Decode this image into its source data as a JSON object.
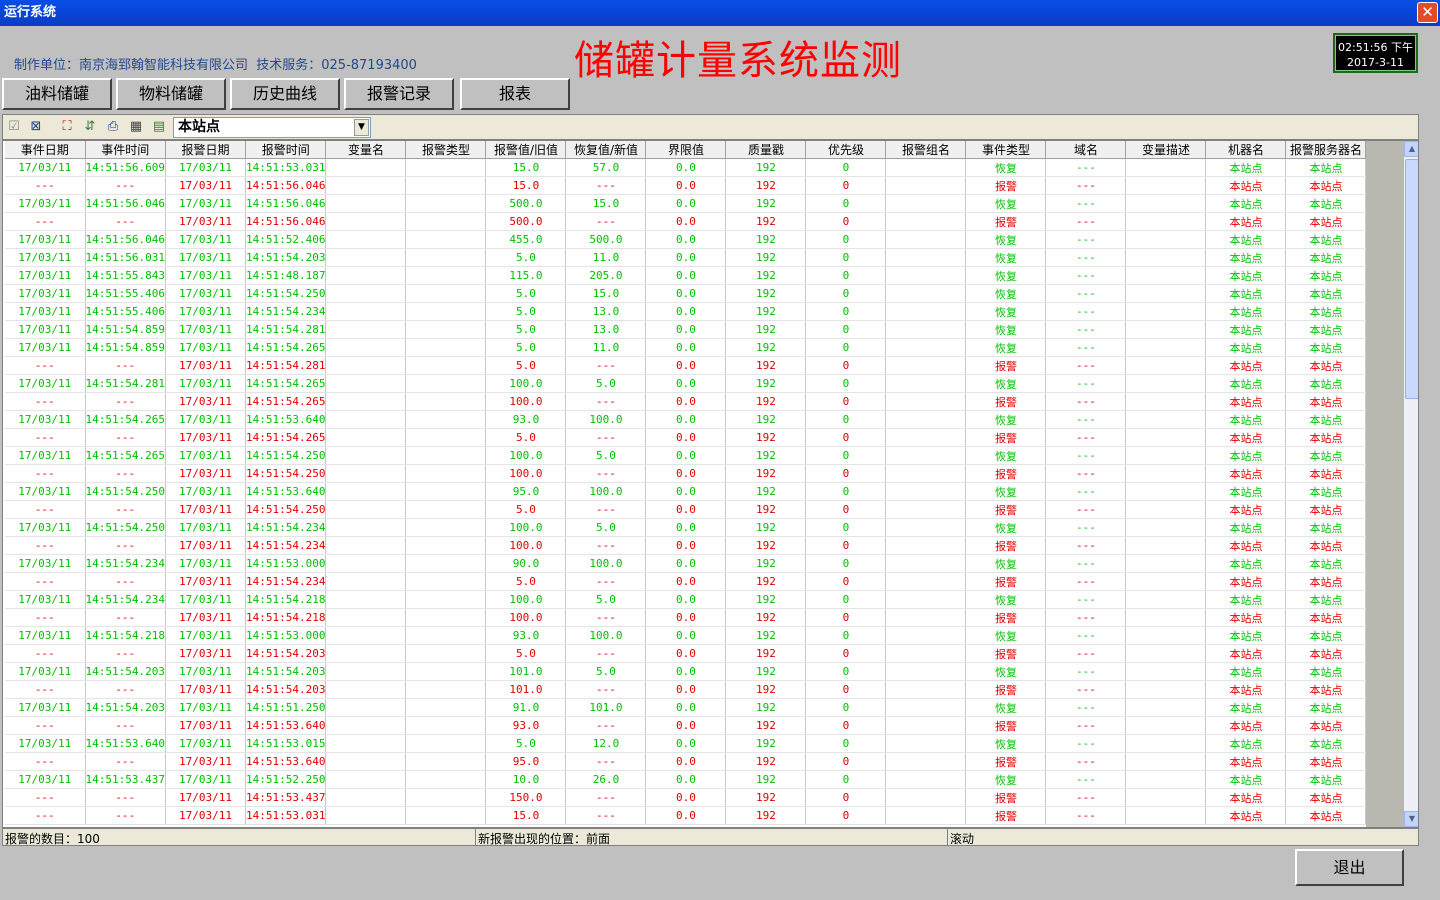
{
  "window": {
    "title": "运行系统"
  },
  "header": {
    "company": "制作单位：南京海郅翰智能科技有限公司  技术服务：025-87193400",
    "title": "储罐计量系统监测",
    "clock_time": "02:51:56 下午",
    "clock_date": "2017-3-11"
  },
  "tabs": [
    "油料储罐",
    "物料储罐",
    "历史曲线",
    "报警记录",
    "报表"
  ],
  "toolbar": {
    "station": "本站点"
  },
  "table": {
    "columns": [
      "事件日期",
      "事件时间",
      "报警日期",
      "报警时间",
      "变量名",
      "报警类型",
      "报警值/旧值",
      "恢复值/新值",
      "界限值",
      "质量戳",
      "优先级",
      "报警组名",
      "事件类型",
      "域名",
      "变量描述",
      "机器名",
      "报警服务器名"
    ],
    "rows": [
      [
        "17/03/11",
        "14:51:56.609",
        "17/03/11",
        "14:51:53.031",
        "",
        "",
        "15.0",
        "57.0",
        "0.0",
        "192",
        "0",
        "",
        "恢复",
        "---",
        "",
        "本站点",
        "本站点"
      ],
      [
        "---",
        "---",
        "17/03/11",
        "14:51:56.046",
        "",
        "",
        "15.0",
        "---",
        "0.0",
        "192",
        "0",
        "",
        "报警",
        "---",
        "",
        "本站点",
        "本站点"
      ],
      [
        "17/03/11",
        "14:51:56.046",
        "17/03/11",
        "14:51:56.046",
        "",
        "",
        "500.0",
        "15.0",
        "0.0",
        "192",
        "0",
        "",
        "恢复",
        "---",
        "",
        "本站点",
        "本站点"
      ],
      [
        "---",
        "---",
        "17/03/11",
        "14:51:56.046",
        "",
        "",
        "500.0",
        "---",
        "0.0",
        "192",
        "0",
        "",
        "报警",
        "---",
        "",
        "本站点",
        "本站点"
      ],
      [
        "17/03/11",
        "14:51:56.046",
        "17/03/11",
        "14:51:52.406",
        "",
        "",
        "455.0",
        "500.0",
        "0.0",
        "192",
        "0",
        "",
        "恢复",
        "---",
        "",
        "本站点",
        "本站点"
      ],
      [
        "17/03/11",
        "14:51:56.031",
        "17/03/11",
        "14:51:54.203",
        "",
        "",
        "5.0",
        "11.0",
        "0.0",
        "192",
        "0",
        "",
        "恢复",
        "---",
        "",
        "本站点",
        "本站点"
      ],
      [
        "17/03/11",
        "14:51:55.843",
        "17/03/11",
        "14:51:48.187",
        "",
        "",
        "115.0",
        "205.0",
        "0.0",
        "192",
        "0",
        "",
        "恢复",
        "---",
        "",
        "本站点",
        "本站点"
      ],
      [
        "17/03/11",
        "14:51:55.406",
        "17/03/11",
        "14:51:54.250",
        "",
        "",
        "5.0",
        "15.0",
        "0.0",
        "192",
        "0",
        "",
        "恢复",
        "---",
        "",
        "本站点",
        "本站点"
      ],
      [
        "17/03/11",
        "14:51:55.406",
        "17/03/11",
        "14:51:54.234",
        "",
        "",
        "5.0",
        "13.0",
        "0.0",
        "192",
        "0",
        "",
        "恢复",
        "---",
        "",
        "本站点",
        "本站点"
      ],
      [
        "17/03/11",
        "14:51:54.859",
        "17/03/11",
        "14:51:54.281",
        "",
        "",
        "5.0",
        "13.0",
        "0.0",
        "192",
        "0",
        "",
        "恢复",
        "---",
        "",
        "本站点",
        "本站点"
      ],
      [
        "17/03/11",
        "14:51:54.859",
        "17/03/11",
        "14:51:54.265",
        "",
        "",
        "5.0",
        "11.0",
        "0.0",
        "192",
        "0",
        "",
        "恢复",
        "---",
        "",
        "本站点",
        "本站点"
      ],
      [
        "---",
        "---",
        "17/03/11",
        "14:51:54.281",
        "",
        "",
        "5.0",
        "---",
        "0.0",
        "192",
        "0",
        "",
        "报警",
        "---",
        "",
        "本站点",
        "本站点"
      ],
      [
        "17/03/11",
        "14:51:54.281",
        "17/03/11",
        "14:51:54.265",
        "",
        "",
        "100.0",
        "5.0",
        "0.0",
        "192",
        "0",
        "",
        "恢复",
        "---",
        "",
        "本站点",
        "本站点"
      ],
      [
        "---",
        "---",
        "17/03/11",
        "14:51:54.265",
        "",
        "",
        "100.0",
        "---",
        "0.0",
        "192",
        "0",
        "",
        "报警",
        "---",
        "",
        "本站点",
        "本站点"
      ],
      [
        "17/03/11",
        "14:51:54.265",
        "17/03/11",
        "14:51:53.640",
        "",
        "",
        "93.0",
        "100.0",
        "0.0",
        "192",
        "0",
        "",
        "恢复",
        "---",
        "",
        "本站点",
        "本站点"
      ],
      [
        "---",
        "---",
        "17/03/11",
        "14:51:54.265",
        "",
        "",
        "5.0",
        "---",
        "0.0",
        "192",
        "0",
        "",
        "报警",
        "---",
        "",
        "本站点",
        "本站点"
      ],
      [
        "17/03/11",
        "14:51:54.265",
        "17/03/11",
        "14:51:54.250",
        "",
        "",
        "100.0",
        "5.0",
        "0.0",
        "192",
        "0",
        "",
        "恢复",
        "---",
        "",
        "本站点",
        "本站点"
      ],
      [
        "---",
        "---",
        "17/03/11",
        "14:51:54.250",
        "",
        "",
        "100.0",
        "---",
        "0.0",
        "192",
        "0",
        "",
        "报警",
        "---",
        "",
        "本站点",
        "本站点"
      ],
      [
        "17/03/11",
        "14:51:54.250",
        "17/03/11",
        "14:51:53.640",
        "",
        "",
        "95.0",
        "100.0",
        "0.0",
        "192",
        "0",
        "",
        "恢复",
        "---",
        "",
        "本站点",
        "本站点"
      ],
      [
        "---",
        "---",
        "17/03/11",
        "14:51:54.250",
        "",
        "",
        "5.0",
        "---",
        "0.0",
        "192",
        "0",
        "",
        "报警",
        "---",
        "",
        "本站点",
        "本站点"
      ],
      [
        "17/03/11",
        "14:51:54.250",
        "17/03/11",
        "14:51:54.234",
        "",
        "",
        "100.0",
        "5.0",
        "0.0",
        "192",
        "0",
        "",
        "恢复",
        "---",
        "",
        "本站点",
        "本站点"
      ],
      [
        "---",
        "---",
        "17/03/11",
        "14:51:54.234",
        "",
        "",
        "100.0",
        "---",
        "0.0",
        "192",
        "0",
        "",
        "报警",
        "---",
        "",
        "本站点",
        "本站点"
      ],
      [
        "17/03/11",
        "14:51:54.234",
        "17/03/11",
        "14:51:53.000",
        "",
        "",
        "90.0",
        "100.0",
        "0.0",
        "192",
        "0",
        "",
        "恢复",
        "---",
        "",
        "本站点",
        "本站点"
      ],
      [
        "---",
        "---",
        "17/03/11",
        "14:51:54.234",
        "",
        "",
        "5.0",
        "---",
        "0.0",
        "192",
        "0",
        "",
        "报警",
        "---",
        "",
        "本站点",
        "本站点"
      ],
      [
        "17/03/11",
        "14:51:54.234",
        "17/03/11",
        "14:51:54.218",
        "",
        "",
        "100.0",
        "5.0",
        "0.0",
        "192",
        "0",
        "",
        "恢复",
        "---",
        "",
        "本站点",
        "本站点"
      ],
      [
        "---",
        "---",
        "17/03/11",
        "14:51:54.218",
        "",
        "",
        "100.0",
        "---",
        "0.0",
        "192",
        "0",
        "",
        "报警",
        "---",
        "",
        "本站点",
        "本站点"
      ],
      [
        "17/03/11",
        "14:51:54.218",
        "17/03/11",
        "14:51:53.000",
        "",
        "",
        "93.0",
        "100.0",
        "0.0",
        "192",
        "0",
        "",
        "恢复",
        "---",
        "",
        "本站点",
        "本站点"
      ],
      [
        "---",
        "---",
        "17/03/11",
        "14:51:54.203",
        "",
        "",
        "5.0",
        "---",
        "0.0",
        "192",
        "0",
        "",
        "报警",
        "---",
        "",
        "本站点",
        "本站点"
      ],
      [
        "17/03/11",
        "14:51:54.203",
        "17/03/11",
        "14:51:54.203",
        "",
        "",
        "101.0",
        "5.0",
        "0.0",
        "192",
        "0",
        "",
        "恢复",
        "---",
        "",
        "本站点",
        "本站点"
      ],
      [
        "---",
        "---",
        "17/03/11",
        "14:51:54.203",
        "",
        "",
        "101.0",
        "---",
        "0.0",
        "192",
        "0",
        "",
        "报警",
        "---",
        "",
        "本站点",
        "本站点"
      ],
      [
        "17/03/11",
        "14:51:54.203",
        "17/03/11",
        "14:51:51.250",
        "",
        "",
        "91.0",
        "101.0",
        "0.0",
        "192",
        "0",
        "",
        "恢复",
        "---",
        "",
        "本站点",
        "本站点"
      ],
      [
        "---",
        "---",
        "17/03/11",
        "14:51:53.640",
        "",
        "",
        "93.0",
        "---",
        "0.0",
        "192",
        "0",
        "",
        "报警",
        "---",
        "",
        "本站点",
        "本站点"
      ],
      [
        "17/03/11",
        "14:51:53.640",
        "17/03/11",
        "14:51:53.015",
        "",
        "",
        "5.0",
        "12.0",
        "0.0",
        "192",
        "0",
        "",
        "恢复",
        "---",
        "",
        "本站点",
        "本站点"
      ],
      [
        "---",
        "---",
        "17/03/11",
        "14:51:53.640",
        "",
        "",
        "95.0",
        "---",
        "0.0",
        "192",
        "0",
        "",
        "报警",
        "---",
        "",
        "本站点",
        "本站点"
      ],
      [
        "17/03/11",
        "14:51:53.437",
        "17/03/11",
        "14:51:52.250",
        "",
        "",
        "10.0",
        "26.0",
        "0.0",
        "192",
        "0",
        "",
        "恢复",
        "---",
        "",
        "本站点",
        "本站点"
      ],
      [
        "---",
        "---",
        "17/03/11",
        "14:51:53.437",
        "",
        "",
        "150.0",
        "---",
        "0.0",
        "192",
        "0",
        "",
        "报警",
        "---",
        "",
        "本站点",
        "本站点"
      ],
      [
        "---",
        "---",
        "17/03/11",
        "14:51:53.031",
        "",
        "",
        "15.0",
        "---",
        "0.0",
        "192",
        "0",
        "",
        "报警",
        "---",
        "",
        "本站点",
        "本站点"
      ]
    ]
  },
  "status": {
    "count": "报警的数目：100",
    "position": "新报警出现的位置：前面",
    "scroll": "滚动"
  },
  "exit_label": "退出",
  "colors": {
    "recover": "#00c000",
    "alarm": "#e00000",
    "title": "#ff0000"
  }
}
